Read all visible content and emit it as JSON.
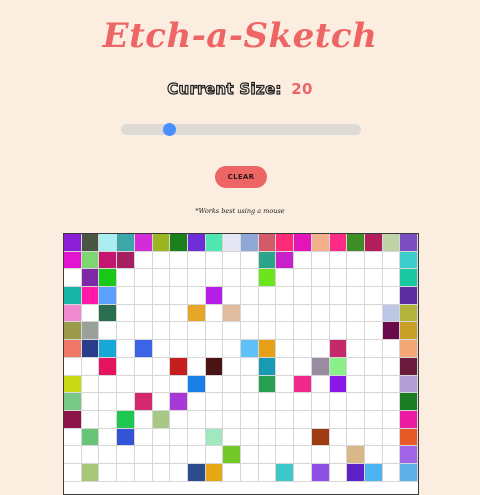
{
  "title": "Etch-a-Sketch",
  "size_label": "Current Size:",
  "size_value": "20",
  "slider": {
    "min": 2,
    "max": 100,
    "value": 20,
    "thumb_color": "#4a90ff",
    "track_color": "#dedad6"
  },
  "clear_label": "CLEAR",
  "note": "*Works best using a mouse",
  "grid": {
    "columns": 20,
    "rows": [
      [
        "#8b1fd6",
        "#4a5544",
        "#a9eef0",
        "#3aa8a8",
        "#d42bd8",
        "#9cb522",
        "#1b7f1b",
        "#6e2dd8",
        "#4fe6b0",
        "#e6e6f5",
        "#8fa8d6",
        "#d45a6a",
        "#ff2a78",
        "#e314b8",
        "#f4b08a",
        "#ff2a86",
        "#3d8f25",
        "#b31e5a",
        "#bed4a6",
        "#7a4ec0"
      ],
      [
        "#e314d0",
        "#7ed672",
        "#c4166e",
        "#a52060",
        null,
        null,
        null,
        null,
        null,
        null,
        null,
        "#2aa58c",
        "#c820c8",
        null,
        null,
        null,
        null,
        null,
        null,
        "#3ccccc"
      ],
      [
        null,
        "#7e2aa8",
        "#19c819",
        null,
        null,
        null,
        null,
        null,
        null,
        null,
        null,
        "#6ce61c",
        null,
        null,
        null,
        null,
        null,
        null,
        null,
        "#19c8a0"
      ],
      [
        "#19b4a8",
        "#ff1aa8",
        "#5aa0ff",
        null,
        null,
        null,
        null,
        null,
        "#b41ee6",
        null,
        null,
        null,
        null,
        null,
        null,
        null,
        null,
        null,
        null,
        "#5a2ca0"
      ],
      [
        "#f08ad0",
        null,
        "#2a6e50",
        null,
        null,
        null,
        null,
        "#e6a628",
        null,
        "#e0bca0",
        null,
        null,
        null,
        null,
        null,
        null,
        null,
        null,
        "#bcc8e6",
        "#b4b43c"
      ],
      [
        "#9a9a4a",
        "#9aa09a",
        null,
        null,
        null,
        null,
        null,
        null,
        null,
        null,
        null,
        null,
        null,
        null,
        null,
        null,
        null,
        null,
        "#6a0a4a",
        "#c8a028"
      ],
      [
        "#f07868",
        "#2c3c8c",
        "#18a8d8",
        null,
        "#3c64e6",
        null,
        null,
        null,
        null,
        null,
        "#60c0f8",
        "#e6a018",
        null,
        null,
        null,
        "#c42a6a",
        null,
        null,
        null,
        "#f4a878"
      ],
      [
        null,
        null,
        "#e61460",
        null,
        null,
        null,
        "#c41e1e",
        null,
        "#4a1414",
        null,
        null,
        "#189ab4",
        null,
        null,
        "#9a8ca0",
        "#8af08a",
        null,
        null,
        null,
        "#6a1a3a"
      ],
      [
        "#c8d814",
        null,
        null,
        null,
        null,
        null,
        null,
        "#1880e6",
        null,
        null,
        null,
        "#28a050",
        null,
        "#f0288c",
        null,
        "#8a18e6",
        null,
        null,
        null,
        "#b4a0d4"
      ],
      [
        "#78c888",
        null,
        null,
        null,
        "#d4286e",
        null,
        "#a838d8",
        null,
        null,
        null,
        null,
        null,
        null,
        null,
        null,
        null,
        null,
        null,
        null,
        "#1c7c24"
      ],
      [
        "#8c1448",
        null,
        null,
        "#1ec850",
        null,
        "#a8c888",
        null,
        null,
        null,
        null,
        null,
        null,
        null,
        null,
        null,
        null,
        null,
        null,
        null,
        "#ec1aa0"
      ],
      [
        null,
        "#68c478",
        null,
        "#3454d8",
        null,
        null,
        null,
        null,
        "#a0e8c0",
        null,
        null,
        null,
        null,
        null,
        "#a03c14",
        null,
        null,
        null,
        null,
        "#e65a28"
      ],
      [
        null,
        null,
        null,
        null,
        null,
        null,
        null,
        null,
        null,
        "#74c828",
        null,
        null,
        null,
        null,
        null,
        null,
        "#d8b888",
        null,
        null,
        "#a064e6"
      ],
      [
        null,
        "#a8c878",
        null,
        null,
        null,
        null,
        null,
        "#2c4c8c",
        "#e6a814",
        null,
        null,
        null,
        "#3cc8c8",
        null,
        "#8c50e6",
        null,
        "#6020c8",
        "#4cb4f0",
        null,
        "#60b0e8"
      ]
    ]
  }
}
